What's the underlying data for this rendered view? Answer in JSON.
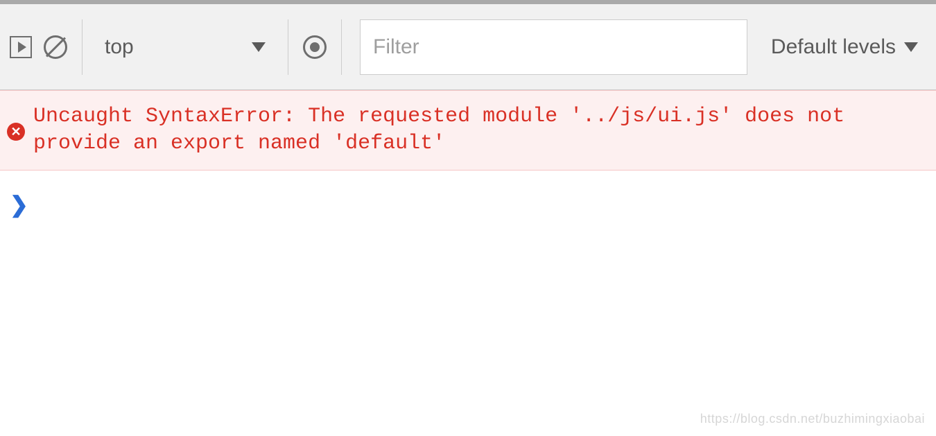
{
  "toolbar": {
    "context_label": "top",
    "filter_placeholder": "Filter",
    "levels_label": "Default levels"
  },
  "console": {
    "error_message": "Uncaught SyntaxError: The requested module '../js/ui.js' does not provide an export named 'default'"
  },
  "watermark": "https://blog.csdn.net/buzhimingxiaobai"
}
